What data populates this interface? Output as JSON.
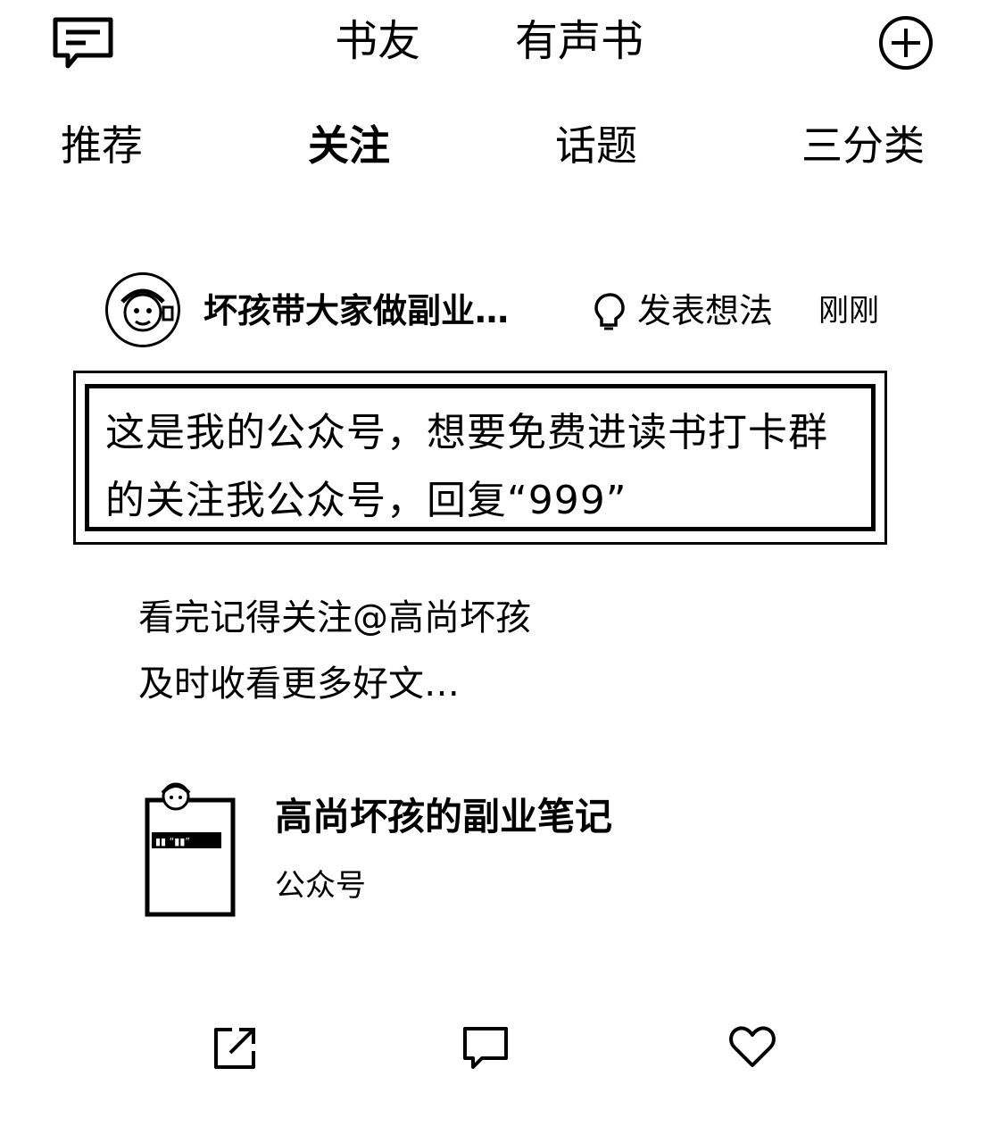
{
  "top_bar": {
    "tabs": [
      "书友",
      "有声书"
    ],
    "left_icon": "message-icon",
    "right_icon": "add-icon"
  },
  "sub_tabs": [
    {
      "label": "推荐",
      "active": false
    },
    {
      "label": "关注",
      "active": true
    },
    {
      "label": "话题",
      "active": false
    },
    {
      "label": "三分类",
      "active": false
    }
  ],
  "post": {
    "author": "坏孩带大家做副业…",
    "action": "发表想法",
    "time": "刚刚",
    "highlight_text": "这是我的公众号，想要免费进读书打卡群的关注我公众号，回复“999”",
    "body_lines": [
      "看完记得关注@高尚坏孩",
      "及时收看更多好文…"
    ],
    "card": {
      "title": "高尚坏孩的副业笔记",
      "subtitle": "公众号"
    }
  },
  "bottom_actions": [
    "share-icon",
    "comment-icon",
    "like-icon"
  ]
}
